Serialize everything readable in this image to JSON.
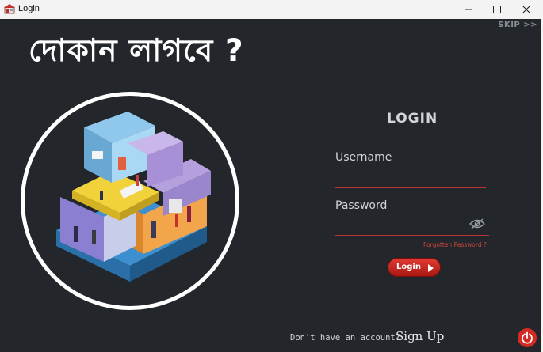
{
  "window": {
    "title": "Login",
    "controls": [
      "minimize-icon",
      "maximize-icon",
      "close-icon"
    ]
  },
  "skip": {
    "label": "SKIP >>"
  },
  "headline": {
    "text": "দোকান লাগবে ?"
  },
  "hero": {
    "icon": "isometric-shop-illustration"
  },
  "login": {
    "title": "LOGIN",
    "username_label": "Username",
    "username_value": "",
    "password_label": "Password",
    "password_value": "",
    "show_password_icon": "eye-slash-icon",
    "forgot_label": "Forgotten Password ?",
    "submit_label": "Login",
    "submit_icon": "play-arrow-icon"
  },
  "footer": {
    "no_account_text": "Don't have an account?",
    "signup_label": "Sign Up",
    "power_icon": "power-icon"
  },
  "colors": {
    "background": "#23262b",
    "accent": "#d42a24",
    "underline": "#b5362e",
    "text": "#d2d4d8"
  }
}
